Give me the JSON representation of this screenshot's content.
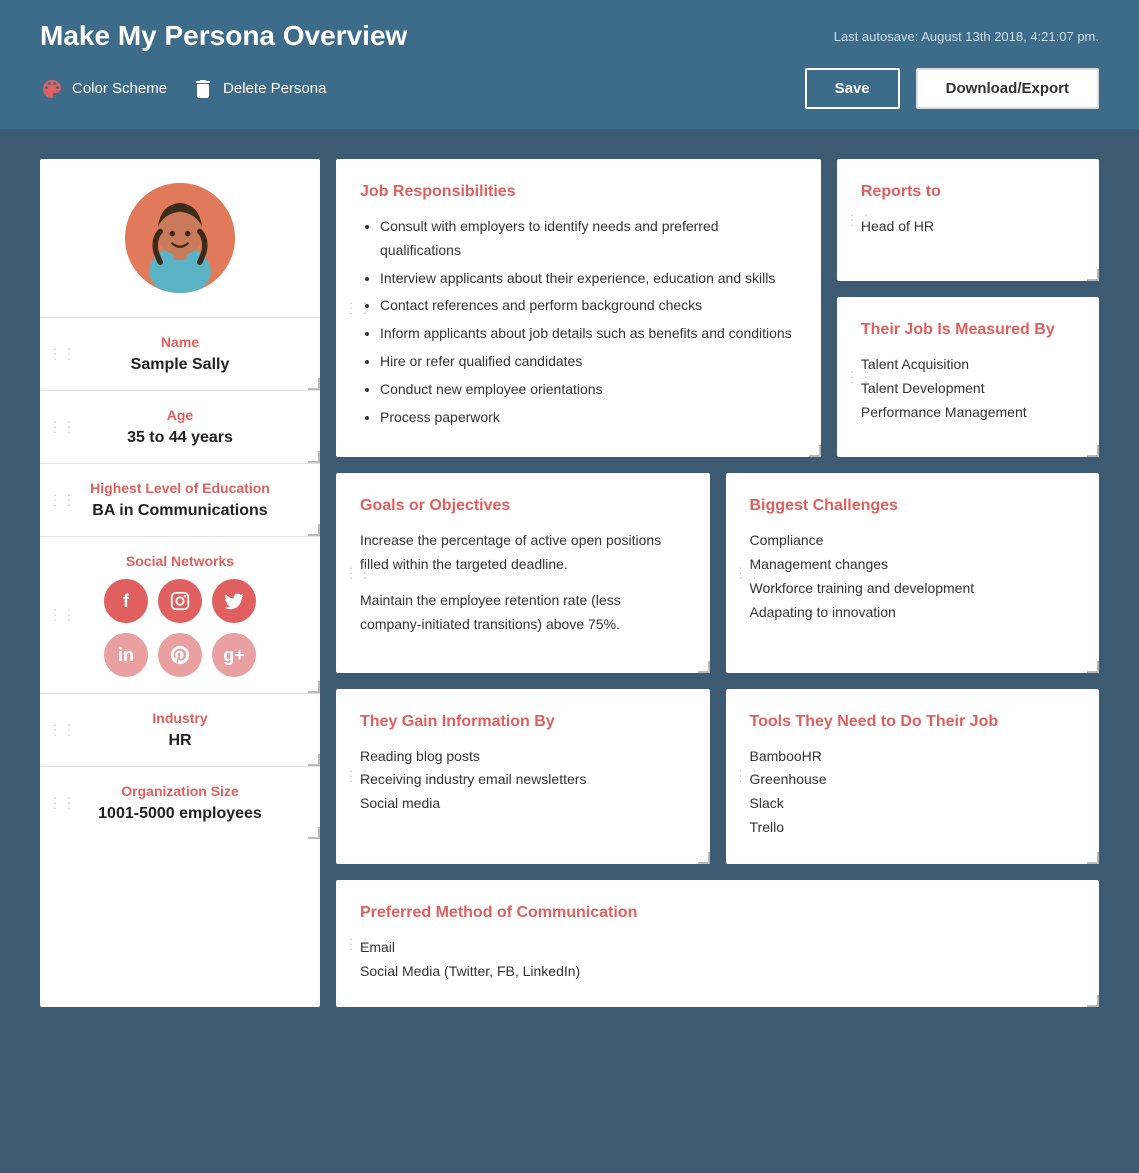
{
  "header": {
    "title": "Make My Persona Overview",
    "autosave": "Last autosave: August 13th 2018, 4:21:07 pm.",
    "color_scheme_label": "Color Scheme",
    "delete_persona_label": "Delete Persona",
    "save_label": "Save",
    "download_label": "Download/Export"
  },
  "left_panel": {
    "name_label": "Name",
    "name_value": "Sample Sally",
    "age_label": "Age",
    "age_value": "35 to 44 years",
    "education_label": "Highest Level of Education",
    "education_value": "BA in Communications",
    "social_label": "Social Networks",
    "social_icons": [
      "f",
      "ig",
      "tw",
      "in",
      "pi",
      "g+"
    ],
    "industry_label": "Industry",
    "industry_value": "HR",
    "org_size_label": "Organization Size",
    "org_size_value": "1001-5000 employees"
  },
  "panels": {
    "job_responsibilities": {
      "title": "Job Responsibilities",
      "items": [
        "Consult with employers to identify needs and preferred qualifications",
        "Interview applicants about their experience, education and skills",
        "Contact references and perform background checks",
        "Inform applicants about job details such as benefits and conditions",
        "Hire or refer qualified candidates",
        "Conduct new employee orientations",
        "Process paperwork"
      ]
    },
    "reports_to": {
      "title": "Reports to",
      "value": "Head of HR"
    },
    "job_measured_by": {
      "title": "Their Job Is Measured By",
      "items": [
        "Talent Acquisition",
        "Talent Development",
        "Performance Management"
      ]
    },
    "goals": {
      "title": "Goals or Objectives",
      "paragraphs": [
        "Increase the percentage of active open positions filled within the targeted deadline.",
        "Maintain the employee retention rate (less company-initiated transitions) above 75%."
      ]
    },
    "biggest_challenges": {
      "title": "Biggest Challenges",
      "items": [
        "Compliance",
        "Management changes",
        "Workforce training and development",
        "Adapating to innovation"
      ]
    },
    "gain_info": {
      "title": "They Gain Information By",
      "items": [
        "Reading blog posts",
        "Receiving industry email newsletters",
        "Social media"
      ]
    },
    "tools": {
      "title": "Tools They Need to Do Their Job",
      "items": [
        "BambooHR",
        "Greenhouse",
        "Slack",
        "Trello"
      ]
    },
    "communication": {
      "title": "Preferred Method of Communication",
      "items": [
        "Email",
        "Social Media (Twitter, FB, LinkedIn)"
      ]
    }
  },
  "colors": {
    "accent": "#e05f5f",
    "header_bg": "#3d6b8a",
    "body_bg": "#3d5a73",
    "social_primary": "#e05f5f",
    "social_secondary": "#e8a0a0"
  }
}
